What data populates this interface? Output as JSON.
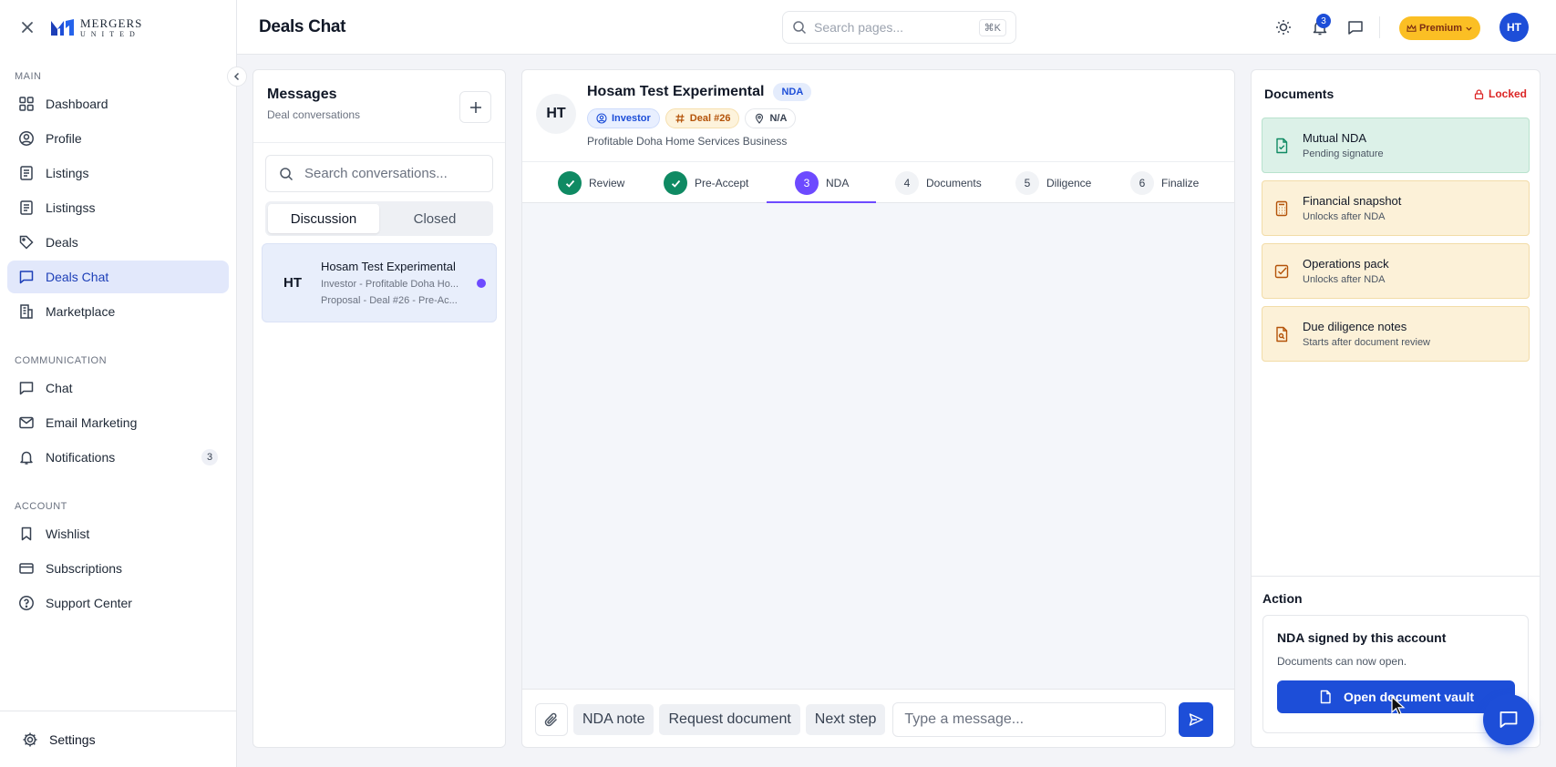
{
  "brand": {
    "line1": "MERGERS",
    "line2": "UNITED"
  },
  "sidebar": {
    "sections": [
      {
        "label": "MAIN"
      },
      {
        "label": "COMMUNICATION"
      },
      {
        "label": "ACCOUNT"
      }
    ],
    "items": [
      {
        "label": "Dashboard",
        "icon": "grid-icon"
      },
      {
        "label": "Profile",
        "icon": "user-circle-icon"
      },
      {
        "label": "Listings",
        "icon": "list-icon"
      },
      {
        "label": "Listingss",
        "icon": "list-icon"
      },
      {
        "label": "Deals",
        "icon": "tag-icon"
      },
      {
        "label": "Deals Chat",
        "icon": "chat-icon",
        "active": true
      },
      {
        "label": "Marketplace",
        "icon": "building-icon"
      },
      {
        "label": "Chat",
        "icon": "chat-icon"
      },
      {
        "label": "Email Marketing",
        "icon": "mail-icon"
      },
      {
        "label": "Notifications",
        "icon": "bell-icon",
        "count": "3"
      },
      {
        "label": "Wishlist",
        "icon": "bookmark-icon"
      },
      {
        "label": "Subscriptions",
        "icon": "card-icon"
      },
      {
        "label": "Support Center",
        "icon": "help-icon"
      }
    ],
    "settings_label": "Settings"
  },
  "topbar": {
    "title": "Deals Chat",
    "search_placeholder": "Search pages...",
    "shortcut": "⌘K",
    "notification_count": "3",
    "premium_label": "Premium",
    "avatar_initials": "HT"
  },
  "messages": {
    "title": "Messages",
    "subtitle": "Deal conversations",
    "search_placeholder": "Search conversations...",
    "tabs": [
      "Discussion",
      "Closed"
    ],
    "conversations": [
      {
        "initials": "HT",
        "name": "Hosam Test Experimental",
        "line1": "Investor - Profitable Doha Ho...",
        "line2": "Proposal - Deal #26 - Pre-Ac..."
      }
    ]
  },
  "chat": {
    "initials": "HT",
    "name": "Hosam Test Experimental",
    "stage_tag": "NDA",
    "chips": {
      "role": "Investor",
      "deal": "Deal #26",
      "location": "N/A"
    },
    "business": "Profitable Doha Home Services Business",
    "steps": [
      {
        "num": "1",
        "label": "Review",
        "state": "done"
      },
      {
        "num": "2",
        "label": "Pre-Accept",
        "state": "done"
      },
      {
        "num": "3",
        "label": "NDA",
        "state": "current"
      },
      {
        "num": "4",
        "label": "Documents",
        "state": "todo"
      },
      {
        "num": "5",
        "label": "Diligence",
        "state": "todo"
      },
      {
        "num": "6",
        "label": "Finalize",
        "state": "todo"
      }
    ],
    "quick_actions": [
      "NDA note",
      "Request document",
      "Next step"
    ],
    "input_placeholder": "Type a message..."
  },
  "documents": {
    "title": "Documents",
    "status": "Locked",
    "items": [
      {
        "title": "Mutual NDA",
        "subtitle": "Pending signature",
        "tone": "green",
        "icon": "doc-check-icon"
      },
      {
        "title": "Financial snapshot",
        "subtitle": "Unlocks after NDA",
        "tone": "amber",
        "icon": "calculator-icon"
      },
      {
        "title": "Operations pack",
        "subtitle": "Unlocks after NDA",
        "tone": "amber",
        "icon": "checkbox-icon"
      },
      {
        "title": "Due diligence notes",
        "subtitle": "Starts after document review",
        "tone": "amber",
        "icon": "doc-search-icon"
      }
    ],
    "action": {
      "heading": "Action",
      "title": "NDA signed by this account",
      "subtitle": "Documents can now open.",
      "button": "Open document vault"
    }
  },
  "colors": {
    "primary": "#1d4ed8",
    "accent": "#6d4aff",
    "success": "#0f8a63",
    "warning": "#fbbf24",
    "danger": "#dc2626"
  }
}
